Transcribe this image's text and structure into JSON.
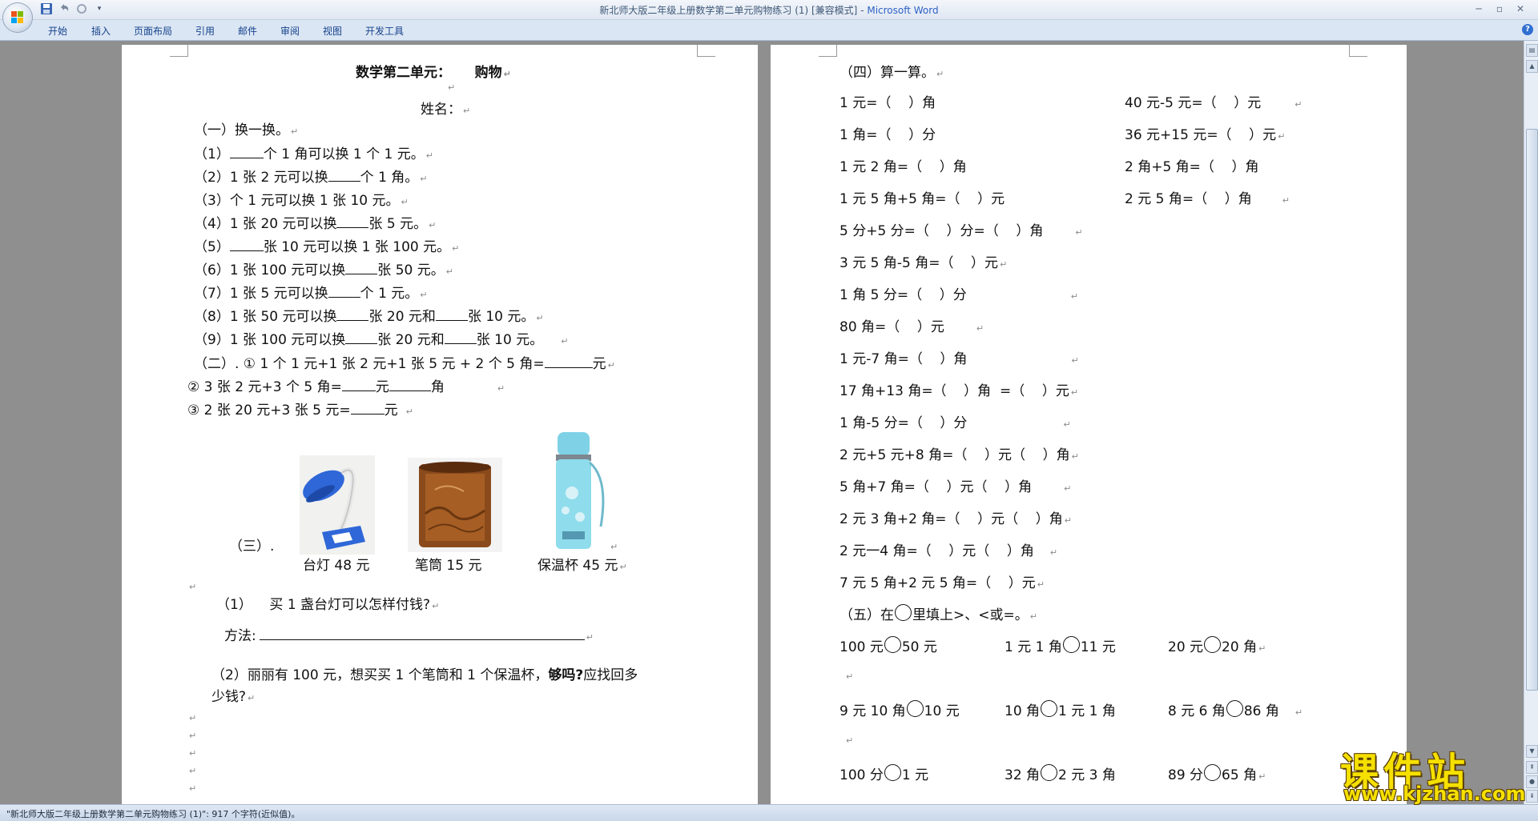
{
  "window": {
    "title": "新北师大版二年级上册数学第二单元购物练习 (1) [兼容模式]",
    "app_name": "Microsoft Word",
    "title_sep": " - "
  },
  "ribbon": {
    "tabs": [
      "开始",
      "插入",
      "页面布局",
      "引用",
      "邮件",
      "审阅",
      "视图",
      "开发工具"
    ]
  },
  "status": {
    "text": "\"新北师大版二年级上册数学第二单元购物练习 (1)\": 917 个字符(近似值)。"
  },
  "watermark": {
    "title": "课件站",
    "url": "www.kjzhan.com"
  },
  "left": {
    "title": "数学第二单元：     购物",
    "name": "姓名：",
    "sec1": "（一）换一换。",
    "q1": [
      "（1）",
      "个 1 角可以换 1 个 1 元。"
    ],
    "q2": [
      "（2）1 张 2 元可以换",
      "个 1 角。"
    ],
    "q3": "（3）个 1 元可以换 1 张 10 元。",
    "q4": [
      "（4）1 张 20 元可以换",
      "张 5 元。"
    ],
    "q5": [
      "（5）",
      "张 10 元可以换 1 张 100 元。"
    ],
    "q6": [
      "（6）1 张 100 元可以换",
      "张 50 元。"
    ],
    "q7": [
      "（7）1 张 5 元可以换",
      "个 1 元。"
    ],
    "q8": [
      "（8）1 张 50 元可以换",
      "张 20 元和",
      "张 10 元。"
    ],
    "q9": [
      "（9）1 张 100 元可以换",
      "张 20 元和",
      "张 10 元。"
    ],
    "sec2": [
      "（二）. ①  1 个 1 元+1 张 2 元+1 张 5 元 + 2 个 5 角=",
      "元"
    ],
    "sec2b": [
      "②  3 张 2 元+3 个 5 角=",
      "元",
      "角"
    ],
    "sec2c": [
      "③  2 张 20 元+3 张 5 元=",
      "元"
    ],
    "sec3": "（三）.",
    "items": [
      {
        "label": "台灯 48 元"
      },
      {
        "label": "笔筒 15 元"
      },
      {
        "label": "保温杯 45 元"
      }
    ],
    "p1": "（1）    买 1 盏台灯可以怎样付钱?",
    "method": "方法:",
    "p2a_1": "（2）丽丽有 100 元，想买买 1 个笔筒和 1 个保温杯，",
    "p2a_2": "够吗?",
    "p2a_3": "应找回多",
    "p2b": "少钱?"
  },
  "right": {
    "sec4": "（四）算一算。",
    "calc_left": [
      "1 元=（    ）角",
      "1 角=（    ）分",
      "1 元 2 角=（    ）角",
      "1 元 5 角+5 角=（    ）元",
      "5 分+5 分=（    ）分=（    ）角",
      "3 元 5 角-5 角=（    ）元",
      "1 角 5 分=（    ）分",
      "80 角=（    ）元",
      "1 元-7 角=（    ）角",
      "17 角+13 角=（    ）角  =（    ）元",
      "1 角-5 分=（    ）分",
      "2 元+5 元+8 角=（    ）元（    ）角",
      "5 角+7 角=（    ）元（    ）角",
      "2 元 3 角+2 角=（    ）元（    ）角",
      "2 元一4 角=（    ）元（    ）角",
      "7 元 5 角+2 元 5 角=（    ）元"
    ],
    "calc_right": [
      "40 元-5 元=（    ）元",
      "36 元+15 元=（    ）元",
      "2 角+5 角=（    ）角",
      "2 元 5 角=（    ）角"
    ],
    "sec5": [
      "（五）在",
      "里填上>、<或=。"
    ],
    "cmp": [
      [
        [
          "100 元",
          "50 元"
        ],
        [
          "1 元 1 角",
          "11 元"
        ],
        [
          "20 元",
          "20 角"
        ]
      ],
      [
        [
          "9 元 10 角",
          "10 元"
        ],
        [
          "10 角",
          "1 元 1 角"
        ],
        [
          "8 元 6 角",
          "86 角"
        ]
      ],
      [
        [
          "100 分",
          "1 元"
        ],
        [
          "32 角",
          "2 元 3 角"
        ],
        [
          "89 分",
          "65 角"
        ]
      ]
    ]
  }
}
